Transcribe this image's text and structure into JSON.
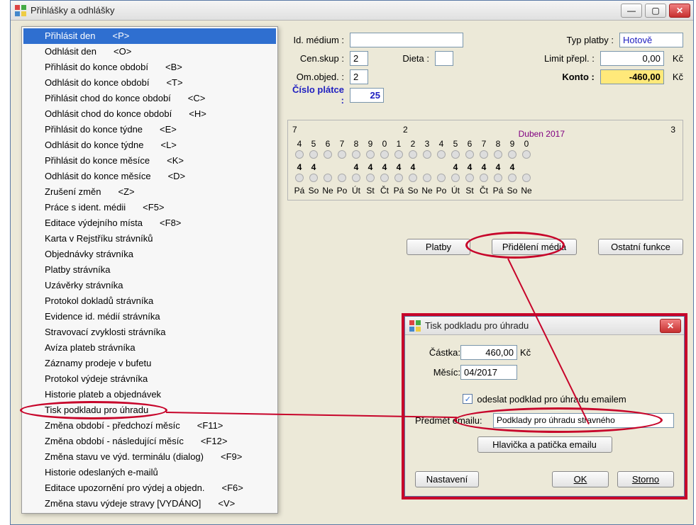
{
  "window": {
    "title": "Přihlášky a odhlášky"
  },
  "menu": {
    "items": [
      {
        "label": "Přihlásit den",
        "shortcut": "<P>"
      },
      {
        "label": "Odhlásit den",
        "shortcut": "<O>"
      },
      {
        "label": "Přihlásit do konce období",
        "shortcut": "<B>"
      },
      {
        "label": "Odhlásit do konce období",
        "shortcut": "<T>"
      },
      {
        "label": "Přihlásit chod do konce období",
        "shortcut": "<C>"
      },
      {
        "label": "Odhlásit chod do konce období",
        "shortcut": "<H>"
      },
      {
        "label": "Přihlásit do konce týdne",
        "shortcut": "<E>"
      },
      {
        "label": "Odhlásit do konce týdne",
        "shortcut": "<L>"
      },
      {
        "label": "Přihlásit do konce měsíce",
        "shortcut": "<K>"
      },
      {
        "label": "Odhlásit do konce měsíce",
        "shortcut": "<D>"
      },
      {
        "label": "Zrušení změn",
        "shortcut": "<Z>"
      },
      {
        "label": "Práce s ident. médii",
        "shortcut": "<F5>"
      },
      {
        "label": "Editace výdejního místa",
        "shortcut": "<F8>"
      },
      {
        "label": "Karta v Rejstříku strávníků",
        "shortcut": ""
      },
      {
        "label": "Objednávky strávníka",
        "shortcut": ""
      },
      {
        "label": "Platby strávníka",
        "shortcut": ""
      },
      {
        "label": "Uzávěrky strávníka",
        "shortcut": ""
      },
      {
        "label": "Protokol dokladů strávníka",
        "shortcut": ""
      },
      {
        "label": "Evidence id. médií strávníka",
        "shortcut": ""
      },
      {
        "label": "Stravovací zvyklosti strávníka",
        "shortcut": ""
      },
      {
        "label": "Avíza plateb strávníka",
        "shortcut": ""
      },
      {
        "label": "Záznamy prodeje v bufetu",
        "shortcut": ""
      },
      {
        "label": "Protokol výdeje strávníka",
        "shortcut": ""
      },
      {
        "label": "Historie plateb a objednávek",
        "shortcut": ""
      },
      {
        "label": "Tisk podkladu pro úhradu",
        "shortcut": ""
      },
      {
        "label": "Změna období - předchozí měsíc",
        "shortcut": "<F11>"
      },
      {
        "label": "Změna období - následující měsíc",
        "shortcut": "<F12>"
      },
      {
        "label": "Změna stavu ve výd. terminálu (dialog)",
        "shortcut": "<F9>"
      },
      {
        "label": "Historie odeslaných e-mailů",
        "shortcut": ""
      },
      {
        "label": "Editace upozornění pro výdej a objedn.",
        "shortcut": "<F6>"
      },
      {
        "label": "Změna stavu výdeje stravy [VYDÁNO]",
        "shortcut": "<V>"
      }
    ]
  },
  "form": {
    "id_medium_lbl": "Id. médium :",
    "cen_skup_lbl": "Cen.skup :",
    "cen_skup_val": "2",
    "dieta_lbl": "Dieta :",
    "om_objed_lbl": "Om.objed. :",
    "om_objed_val": "2",
    "cislo_platce_lbl": "Číslo plátce :",
    "cislo_platce_val": "25",
    "typ_platby_lbl": "Typ platby :",
    "typ_platby_val": "Hotově",
    "limit_lbl": "Limit přepl. :",
    "limit_val": "0,00",
    "konto_lbl": "Konto :",
    "konto_val": "-460,00",
    "kc": "Kč"
  },
  "calendar": {
    "top_right_num": "7",
    "top_right_num2": "2",
    "month": "Duben 2017",
    "top_right_num3": "3",
    "days_nums": [
      "4",
      "5",
      "6",
      "7",
      "8",
      "9",
      "0",
      "1",
      "2",
      "3",
      "4",
      "5",
      "6",
      "7",
      "8",
      "9",
      "0"
    ],
    "midrow": [
      "4",
      "4",
      "",
      "",
      "4",
      "4",
      "4",
      "4",
      "4",
      "",
      "",
      "4",
      "4",
      "4",
      "4",
      "4",
      ""
    ],
    "wkdays": [
      "Pá",
      "So",
      "Ne",
      "Po",
      "Út",
      "St",
      "Čt",
      "Pá",
      "So",
      "Ne",
      "Po",
      "Út",
      "St",
      "Čt",
      "Pá",
      "So",
      "Ne"
    ]
  },
  "buttons": {
    "platby": "Platby",
    "prideleni": "Přidělení média",
    "ostatni": "Ostatní funkce"
  },
  "dialog": {
    "title": "Tisk podkladu pro úhradu",
    "castka_lbl": "Částka:",
    "castka_val": "460,00",
    "kc": "Kč",
    "mesic_lbl": "Měsíc:",
    "mesic_val": "04/2017",
    "chk_label": "odeslat podklad pro úhradu emailem",
    "predmet_lbl": "Předmět emailu:",
    "predmet_val": "Podklady pro úhradu stravného",
    "hlavicka_btn": "Hlavička a patička emailu",
    "nastaveni_btn": "Nastavení",
    "ok_btn": "OK",
    "storno_btn": "Storno"
  }
}
